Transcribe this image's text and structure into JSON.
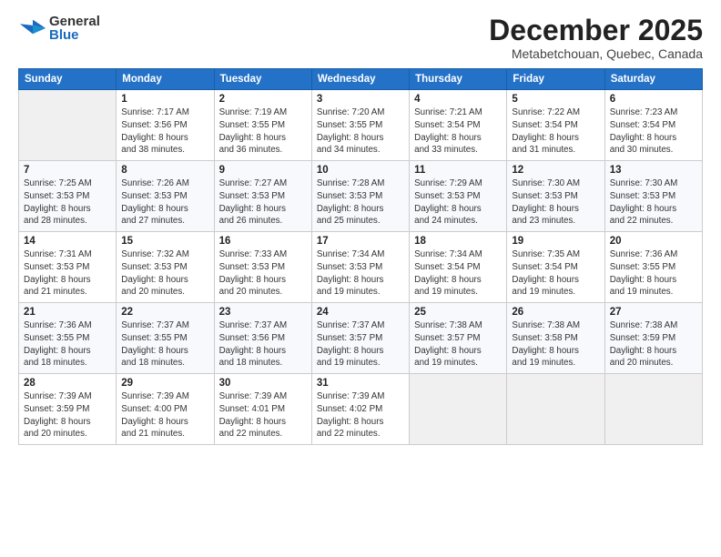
{
  "header": {
    "logo_general": "General",
    "logo_blue": "Blue",
    "month_title": "December 2025",
    "subtitle": "Metabetchouan, Quebec, Canada"
  },
  "weekdays": [
    "Sunday",
    "Monday",
    "Tuesday",
    "Wednesday",
    "Thursday",
    "Friday",
    "Saturday"
  ],
  "weeks": [
    [
      {
        "day": "",
        "info": ""
      },
      {
        "day": "1",
        "info": "Sunrise: 7:17 AM\nSunset: 3:56 PM\nDaylight: 8 hours\nand 38 minutes."
      },
      {
        "day": "2",
        "info": "Sunrise: 7:19 AM\nSunset: 3:55 PM\nDaylight: 8 hours\nand 36 minutes."
      },
      {
        "day": "3",
        "info": "Sunrise: 7:20 AM\nSunset: 3:55 PM\nDaylight: 8 hours\nand 34 minutes."
      },
      {
        "day": "4",
        "info": "Sunrise: 7:21 AM\nSunset: 3:54 PM\nDaylight: 8 hours\nand 33 minutes."
      },
      {
        "day": "5",
        "info": "Sunrise: 7:22 AM\nSunset: 3:54 PM\nDaylight: 8 hours\nand 31 minutes."
      },
      {
        "day": "6",
        "info": "Sunrise: 7:23 AM\nSunset: 3:54 PM\nDaylight: 8 hours\nand 30 minutes."
      }
    ],
    [
      {
        "day": "7",
        "info": "Sunrise: 7:25 AM\nSunset: 3:53 PM\nDaylight: 8 hours\nand 28 minutes."
      },
      {
        "day": "8",
        "info": "Sunrise: 7:26 AM\nSunset: 3:53 PM\nDaylight: 8 hours\nand 27 minutes."
      },
      {
        "day": "9",
        "info": "Sunrise: 7:27 AM\nSunset: 3:53 PM\nDaylight: 8 hours\nand 26 minutes."
      },
      {
        "day": "10",
        "info": "Sunrise: 7:28 AM\nSunset: 3:53 PM\nDaylight: 8 hours\nand 25 minutes."
      },
      {
        "day": "11",
        "info": "Sunrise: 7:29 AM\nSunset: 3:53 PM\nDaylight: 8 hours\nand 24 minutes."
      },
      {
        "day": "12",
        "info": "Sunrise: 7:30 AM\nSunset: 3:53 PM\nDaylight: 8 hours\nand 23 minutes."
      },
      {
        "day": "13",
        "info": "Sunrise: 7:30 AM\nSunset: 3:53 PM\nDaylight: 8 hours\nand 22 minutes."
      }
    ],
    [
      {
        "day": "14",
        "info": "Sunrise: 7:31 AM\nSunset: 3:53 PM\nDaylight: 8 hours\nand 21 minutes."
      },
      {
        "day": "15",
        "info": "Sunrise: 7:32 AM\nSunset: 3:53 PM\nDaylight: 8 hours\nand 20 minutes."
      },
      {
        "day": "16",
        "info": "Sunrise: 7:33 AM\nSunset: 3:53 PM\nDaylight: 8 hours\nand 20 minutes."
      },
      {
        "day": "17",
        "info": "Sunrise: 7:34 AM\nSunset: 3:53 PM\nDaylight: 8 hours\nand 19 minutes."
      },
      {
        "day": "18",
        "info": "Sunrise: 7:34 AM\nSunset: 3:54 PM\nDaylight: 8 hours\nand 19 minutes."
      },
      {
        "day": "19",
        "info": "Sunrise: 7:35 AM\nSunset: 3:54 PM\nDaylight: 8 hours\nand 19 minutes."
      },
      {
        "day": "20",
        "info": "Sunrise: 7:36 AM\nSunset: 3:55 PM\nDaylight: 8 hours\nand 19 minutes."
      }
    ],
    [
      {
        "day": "21",
        "info": "Sunrise: 7:36 AM\nSunset: 3:55 PM\nDaylight: 8 hours\nand 18 minutes."
      },
      {
        "day": "22",
        "info": "Sunrise: 7:37 AM\nSunset: 3:55 PM\nDaylight: 8 hours\nand 18 minutes."
      },
      {
        "day": "23",
        "info": "Sunrise: 7:37 AM\nSunset: 3:56 PM\nDaylight: 8 hours\nand 18 minutes."
      },
      {
        "day": "24",
        "info": "Sunrise: 7:37 AM\nSunset: 3:57 PM\nDaylight: 8 hours\nand 19 minutes."
      },
      {
        "day": "25",
        "info": "Sunrise: 7:38 AM\nSunset: 3:57 PM\nDaylight: 8 hours\nand 19 minutes."
      },
      {
        "day": "26",
        "info": "Sunrise: 7:38 AM\nSunset: 3:58 PM\nDaylight: 8 hours\nand 19 minutes."
      },
      {
        "day": "27",
        "info": "Sunrise: 7:38 AM\nSunset: 3:59 PM\nDaylight: 8 hours\nand 20 minutes."
      }
    ],
    [
      {
        "day": "28",
        "info": "Sunrise: 7:39 AM\nSunset: 3:59 PM\nDaylight: 8 hours\nand 20 minutes."
      },
      {
        "day": "29",
        "info": "Sunrise: 7:39 AM\nSunset: 4:00 PM\nDaylight: 8 hours\nand 21 minutes."
      },
      {
        "day": "30",
        "info": "Sunrise: 7:39 AM\nSunset: 4:01 PM\nDaylight: 8 hours\nand 22 minutes."
      },
      {
        "day": "31",
        "info": "Sunrise: 7:39 AM\nSunset: 4:02 PM\nDaylight: 8 hours\nand 22 minutes."
      },
      {
        "day": "",
        "info": ""
      },
      {
        "day": "",
        "info": ""
      },
      {
        "day": "",
        "info": ""
      }
    ]
  ]
}
